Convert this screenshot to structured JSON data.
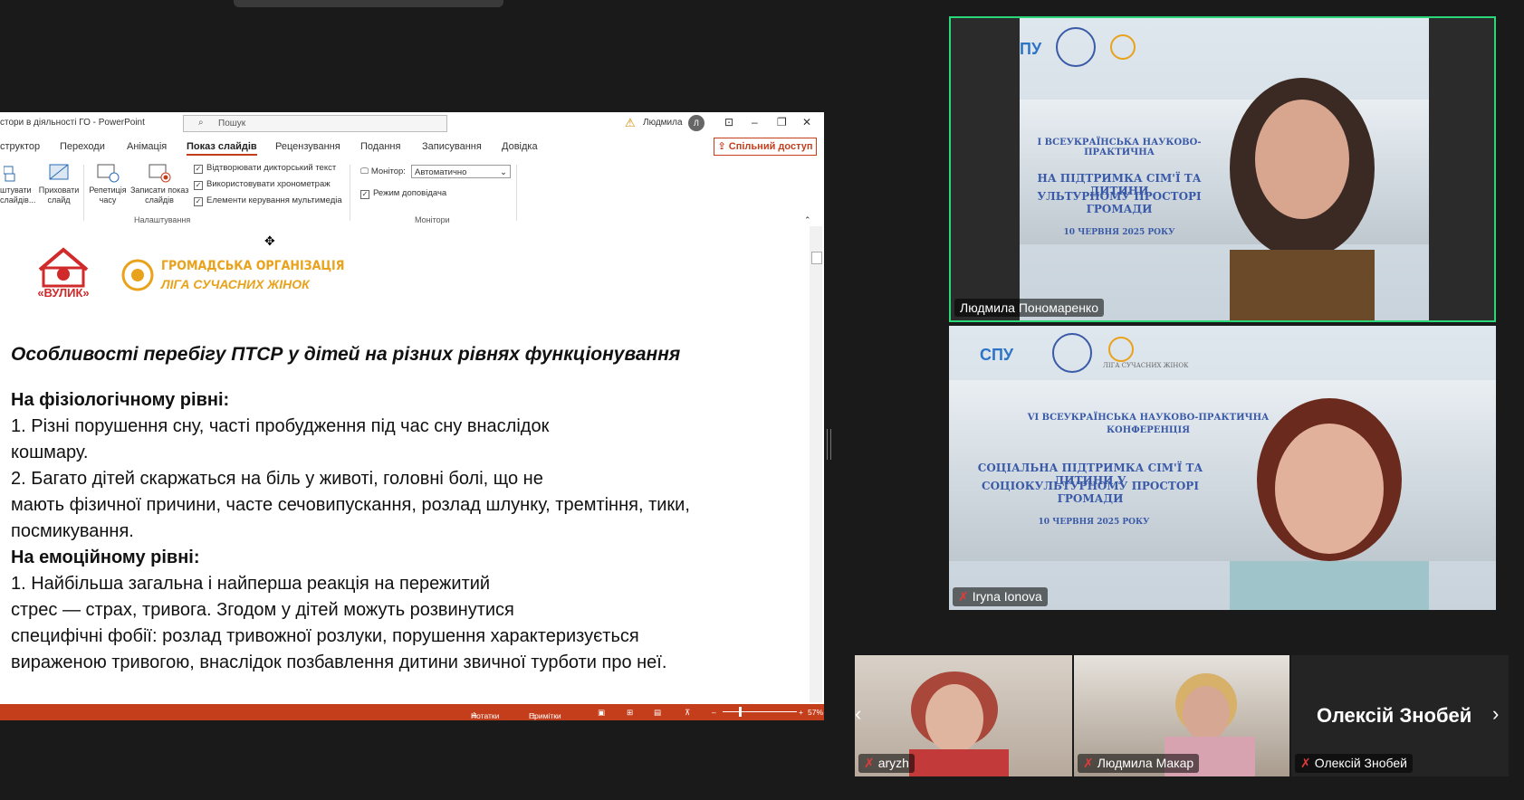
{
  "powerpoint": {
    "doc_title": "стори в діяльності ГО  -  PowerPoint",
    "search_placeholder": "Пошук",
    "user_name": "Людмила",
    "user_initial": "Л",
    "tabs": [
      "структор",
      "Переходи",
      "Анімація",
      "Показ слайдів",
      "Рецензування",
      "Подання",
      "Записування",
      "Довідка"
    ],
    "share_label": "Спільний доступ",
    "ribbon": {
      "btn1": "штувати\nслайдів...",
      "btn2": "Приховати\nслайд",
      "btn3": "Репетиція\nчасу",
      "btn4": "Записати показ\nслайдів",
      "chk1": "Відтворювати дикторський текст",
      "chk2": "Використовувати хронометраж",
      "chk3": "Елементи керування мультимедіа",
      "group1": "Налаштування",
      "monitor_label": "Монітор:",
      "monitor_value": "Автоматично",
      "presenter_mode": "Режим доповідача",
      "group2": "Монітори"
    },
    "slide": {
      "logo_text": "«ВУЛИК»",
      "org_line1": "ГРОМАДСЬКА ОРГАНІЗАЦІЯ",
      "org_line2": "ЛІГА СУЧАСНИХ ЖІНОК",
      "headline": "Особливості перебігу ПТСР у дітей на різних рівнях функціонування",
      "h1": "На фізіологічному рівні:",
      "l1": "1. Різні порушення сну, часті пробудження під час сну внаслідок",
      "l2": "кошмару.",
      "l3": "2. Багато дітей скаржаться на біль у животі, головні болі, що не",
      "l4": "мають фізичної причини, часте сечовипускання, розлад шлунку, тремтіння, тики,",
      "l5": "посмикування.",
      "h2": "На емоційному рівні:",
      "l6": "1. Найбільша загальна і найперша реакція на пережитий",
      "l7": "стрес — страх, тривога. Згодом у дітей можуть розвинутися",
      "l8": "специфічні фобії: розлад тривожної розлуки, порушення характеризується",
      "l9": "вираженою тривогою, внаслідок позбавлення дитини звичної турботи про неї."
    },
    "status": {
      "notes": "Нотатки",
      "comments": "Примітки",
      "zoom": "57%"
    }
  },
  "participants": {
    "p1": "Людмила Пономаренко",
    "p2": "Iryna Ionova",
    "p3": "aryzh",
    "p4": "Людмила Макар",
    "p5": "Олексій Знобей",
    "p5_big": "Олексій Знобей"
  },
  "conference_bg": {
    "spu": "СПУ",
    "league": "ЛІГА СУЧАСНИХ ЖІНОК",
    "line1": "VI ВСЕУКРАЇНСЬКА НАУКОВО-ПРАКТИЧНА",
    "line2": "КОНФЕРЕНЦІЯ",
    "line3": "СОЦІАЛЬНА ПІДТРИМКА СІМ'Ї ТА ДИТИНИ У",
    "line4": "СОЦІОКУЛЬТУРНОМУ ПРОСТОРІ  ГРОМАДИ",
    "date": "10 ЧЕРВНЯ 2025 РОКУ",
    "t1_line1": "І ВСЕУКРАЇНСЬКА НАУКОВО-ПРАКТИЧНА",
    "t1_line3": "НА ПІДТРИМКА СІМ'Ї ТА ДИТИНИ",
    "t1_line4": "УЛЬТУРНОМУ ПРОСТОРІ  ГРОМАДИ",
    "t1_spu": "ПУ"
  }
}
